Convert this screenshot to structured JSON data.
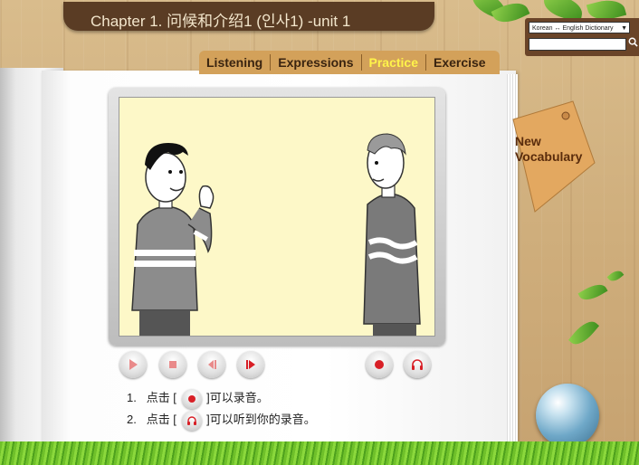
{
  "header": {
    "chapter_title": "Chapter 1. 问候和介绍1 (인사1) -unit 1"
  },
  "dictionary": {
    "selected": "Korean ↔ English Dictionary",
    "search_value": "",
    "search_icon": "magnifier-icon"
  },
  "tabs": [
    {
      "label": "Listening",
      "active": false
    },
    {
      "label": "Expressions",
      "active": false
    },
    {
      "label": "Practice",
      "active": true
    },
    {
      "label": "Exercise",
      "active": false
    }
  ],
  "vocabulary_tag": {
    "line1": "New",
    "line2": "Vocabulary"
  },
  "controls": [
    {
      "name": "play-icon"
    },
    {
      "name": "stop-icon"
    },
    {
      "name": "previous-icon"
    },
    {
      "name": "next-icon"
    },
    {
      "name": "record-icon"
    },
    {
      "name": "headphones-icon"
    }
  ],
  "instructions": [
    {
      "number": "1.",
      "prefix": "点击 [",
      "suffix": "]可以录音。",
      "icon": "record-icon"
    },
    {
      "number": "2.",
      "prefix": "点击 [",
      "suffix": "]可以听到你的录音。",
      "icon": "headphones-icon"
    }
  ],
  "colors": {
    "active_tab": "#fff34a",
    "record_red": "#d81f26",
    "title_bar": "#5a3c24"
  }
}
